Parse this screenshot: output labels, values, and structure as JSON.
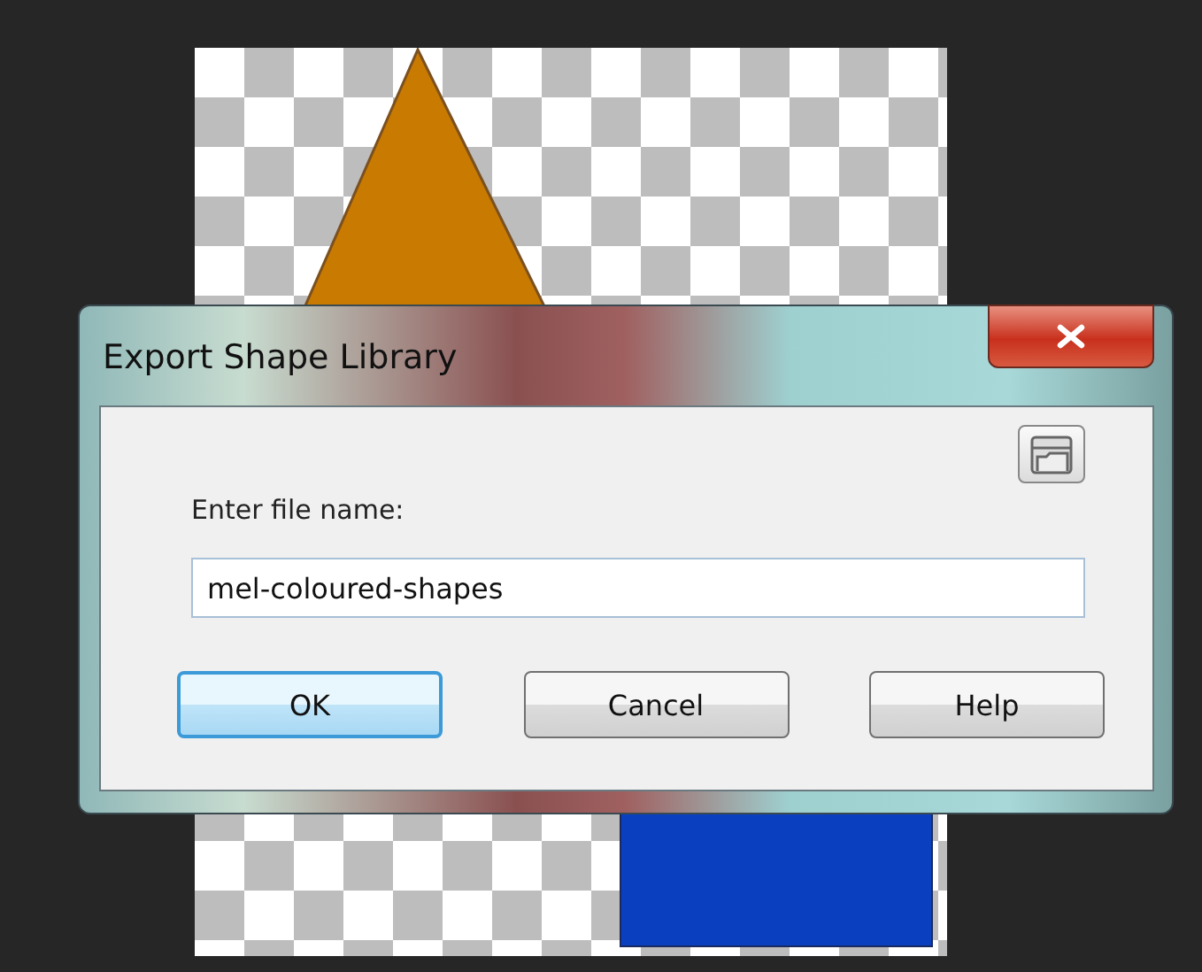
{
  "dialog": {
    "title": "Export Shape Library"
  },
  "field": {
    "label": "Enter file name:",
    "value": "mel-coloured-shapes"
  },
  "buttons": [
    {
      "label": "OK",
      "default": true
    },
    {
      "label": "Cancel",
      "default": false
    },
    {
      "label": "Help",
      "default": false
    }
  ]
}
